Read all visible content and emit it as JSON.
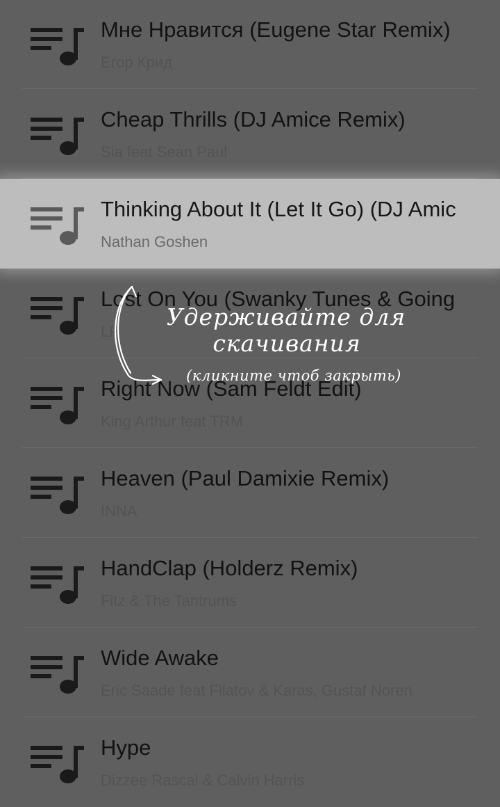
{
  "tracks": [
    {
      "title": "Мне Нравится (Eugene Star Remix)",
      "artist": "Егор Крид"
    },
    {
      "title": "Cheap Thrills (DJ Amice Remix)",
      "artist": "Sia feat Sean Paul"
    },
    {
      "title": "Thinking About It (Let It Go) (DJ Amice Remix)",
      "artist": "Nathan Goshen"
    },
    {
      "title": "Lost On You (Swanky Tunes & Going Deeper Remix)",
      "artist": "LP"
    },
    {
      "title": "Right Now (Sam Feldt Edit)",
      "artist": "King Arthur feat TRM"
    },
    {
      "title": "Heaven (Paul Damixie Remix)",
      "artist": "INNA"
    },
    {
      "title": "HandClap (Holderz Remix)",
      "artist": "Fitz & The Tantrums"
    },
    {
      "title": "Wide Awake",
      "artist": "Eric Saade feat Filatov & Karas, Gustaf Noren"
    },
    {
      "title": "Hype",
      "artist": "Dizzee Rascal & Calvin Harris"
    }
  ],
  "highlighted_index": 2,
  "track_icon": "playlist-music-icon",
  "hint": {
    "line1": "Удерживайте для",
    "line2": "скачивания",
    "sub": "(кликните чтоб закрыть)",
    "arrow_icon": "curved-arrow-icon"
  },
  "colors": {
    "background": "#5f5f5f",
    "highlight_row": "#bdbdbd",
    "title_text": "#121212",
    "artist_text": "#535353",
    "hint_text": "#ffffff"
  }
}
